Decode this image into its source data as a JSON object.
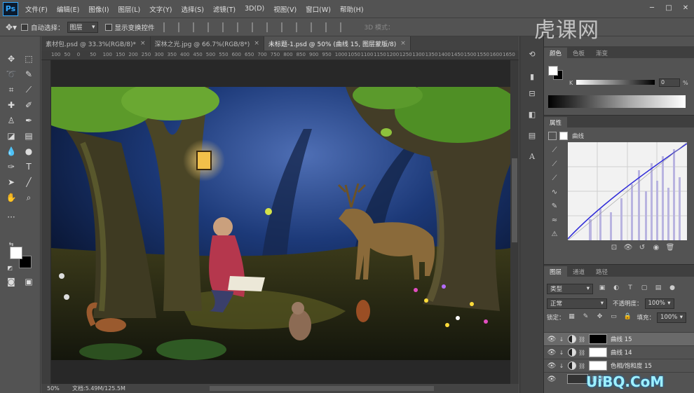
{
  "app": {
    "logo": "Ps"
  },
  "menu": [
    "文件(F)",
    "编辑(E)",
    "图像(I)",
    "图层(L)",
    "文字(Y)",
    "选择(S)",
    "滤镜(T)",
    "3D(D)",
    "视图(V)",
    "窗口(W)",
    "帮助(H)"
  ],
  "options": {
    "auto_select_label": "自动选择：",
    "auto_select_value": "图层",
    "transform_label": "显示变换控件",
    "mode_3d": "3D 模式："
  },
  "tabs": [
    {
      "label": "素材包.psd @ 33.3%(RGB/8)*",
      "close": "×"
    },
    {
      "label": "深林之光.jpg @ 66.7%(RGB/8*)",
      "close": "×"
    },
    {
      "label": "未标题-1.psd @ 50% (曲线 15, 图层蒙版/8)",
      "close": "×"
    }
  ],
  "ruler": [
    "100",
    "50",
    "0",
    "50",
    "100",
    "150",
    "200",
    "250",
    "300",
    "350",
    "400",
    "450",
    "500",
    "550",
    "600",
    "650",
    "700",
    "750",
    "800",
    "850",
    "900",
    "950",
    "1000",
    "1050",
    "1100",
    "1150",
    "1200",
    "1250",
    "1300",
    "1350",
    "1400",
    "1450",
    "1500",
    "1550",
    "1600",
    "1650",
    "1700"
  ],
  "status": {
    "zoom": "50%",
    "doc": "文档:5.49M/125.5M"
  },
  "color_panel": {
    "tabs": [
      "颜色",
      "色板",
      "渐变"
    ],
    "channel": "K",
    "value": "0",
    "unit": "%"
  },
  "properties": {
    "title": "属性",
    "adjustment": "曲线"
  },
  "layers_panel": {
    "tabs": [
      "图层",
      "通道",
      "路径"
    ],
    "filter": "类型",
    "blend": "正常",
    "opacity_label": "不透明度：",
    "opacity": "100%",
    "lock_label": "锁定：",
    "fill_label": "填充：",
    "fill": "100%",
    "layers": [
      {
        "name": "曲线 15",
        "mask_color": "#000000",
        "selected": true
      },
      {
        "name": "曲线 14",
        "mask_color": "#ffffff",
        "selected": false
      },
      {
        "name": "色相/饱和度 15",
        "mask_color": "#ffffff",
        "selected": false
      },
      {
        "name": "背景",
        "mask_color": "#333333",
        "selected": false
      }
    ]
  },
  "watermarks": {
    "top": "虎课网",
    "bottom": "UiBQ.CoM"
  },
  "colors": {
    "ps_blue": "#31a8ff",
    "panel_bg": "#535353",
    "canvas_bg": "#282828"
  }
}
